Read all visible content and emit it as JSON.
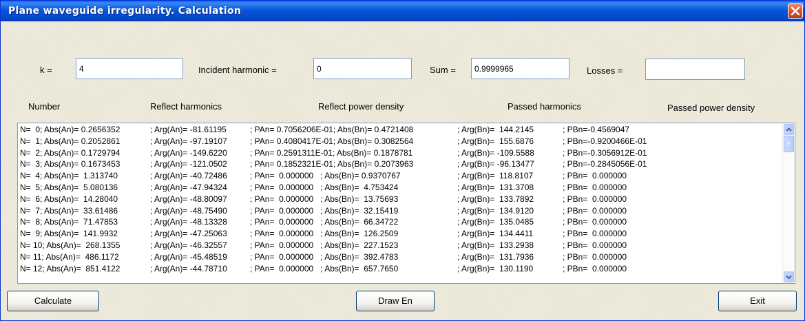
{
  "window": {
    "title": "Plane waveguide irregularity. Calculation"
  },
  "inputs": {
    "k_label": "k =",
    "k_value": "4",
    "incident_label": "Incident harmonic =",
    "incident_value": "0",
    "sum_label": "Sum =",
    "sum_value": "0.9999965",
    "losses_label": "Losses =",
    "losses_value": ""
  },
  "columns": [
    "Number",
    "Reflect harmonics",
    "Reflect power density",
    "Passed harmonics",
    "Passed power density"
  ],
  "results": [
    [
      "N=  0; Abs(An)= 0.2656352",
      "; Arg(An)= -81.61195",
      "; PAn= 0.7056206E-01; Abs(Bn)= 0.4721408",
      "; Arg(Bn)=  144.2145",
      "; PBn=-0.4569047"
    ],
    [
      "N=  1; Abs(An)= 0.2052861",
      "; Arg(An)= -97.19107",
      "; PAn= 0.4080417E-01; Abs(Bn)= 0.3082564",
      "; Arg(Bn)=  155.6876",
      "; PBn=-0.9200466E-01"
    ],
    [
      "N=  2; Abs(An)= 0.1729794",
      "; Arg(An)= -149.6220",
      "; PAn= 0.2591311E-01; Abs(Bn)= 0.1878781",
      "; Arg(Bn)= -109.5588",
      "; PBn=-0.3056912E-01"
    ],
    [
      "N=  3; Abs(An)= 0.1673453",
      "; Arg(An)= -121.0502",
      "; PAn= 0.1852321E-01; Abs(Bn)= 0.2073963",
      "; Arg(Bn)= -96.13477",
      "; PBn=-0.2845056E-01"
    ],
    [
      "N=  4; Abs(An)=  1.313740",
      "; Arg(An)= -40.72486",
      "; PAn=  0.000000   ; Abs(Bn)= 0.9370767",
      "; Arg(Bn)=  118.8107",
      "; PBn=  0.000000"
    ],
    [
      "N=  5; Abs(An)=  5.080136",
      "; Arg(An)= -47.94324",
      "; PAn=  0.000000   ; Abs(Bn)=  4.753424",
      "; Arg(Bn)=  131.3708",
      "; PBn=  0.000000"
    ],
    [
      "N=  6; Abs(An)=  14.28040",
      "; Arg(An)= -48.80097",
      "; PAn=  0.000000   ; Abs(Bn)=  13.75693",
      "; Arg(Bn)=  133.7892",
      "; PBn=  0.000000"
    ],
    [
      "N=  7; Abs(An)=  33.61486",
      "; Arg(An)= -48.75490",
      "; PAn=  0.000000   ; Abs(Bn)=  32.15419",
      "; Arg(Bn)=  134.9120",
      "; PBn=  0.000000"
    ],
    [
      "N=  8; Abs(An)=  71.47853",
      "; Arg(An)= -48.13328",
      "; PAn=  0.000000   ; Abs(Bn)=  66.34722",
      "; Arg(Bn)=  135.0485",
      "; PBn=  0.000000"
    ],
    [
      "N=  9; Abs(An)=  141.9932",
      "; Arg(An)= -47.25063",
      "; PAn=  0.000000   ; Abs(Bn)=  126.2509",
      "; Arg(Bn)=  134.4411",
      "; PBn=  0.000000"
    ],
    [
      "N= 10; Abs(An)=  268.1355",
      "; Arg(An)= -46.32557",
      "; PAn=  0.000000   ; Abs(Bn)=  227.1523",
      "; Arg(Bn)=  133.2938",
      "; PBn=  0.000000"
    ],
    [
      "N= 11; Abs(An)=  486.1172",
      "; Arg(An)= -45.48519",
      "; PAn=  0.000000   ; Abs(Bn)=  392.4783",
      "; Arg(Bn)=  131.7936",
      "; PBn=  0.000000"
    ],
    [
      "N= 12; Abs(An)=  851.4122",
      "; Arg(An)= -44.78710",
      "; PAn=  0.000000   ; Abs(Bn)=  657.7650",
      "; Arg(Bn)=  130.1190",
      "; PBn=  0.000000"
    ]
  ],
  "buttons": {
    "calculate": "Calculate",
    "draw": "Draw En",
    "exit": "Exit"
  },
  "icons": {
    "close": "close-icon",
    "scroll_up": "scroll-up-arrow-icon",
    "scroll_down": "scroll-down-arrow-icon",
    "thumb": "scroll-thumb-grip-icon"
  },
  "colors": {
    "title_bar": "#0a5fe6",
    "close_button": "#d8512f",
    "window_bg": "#ece9d8",
    "field_border": "#7f9db9"
  }
}
